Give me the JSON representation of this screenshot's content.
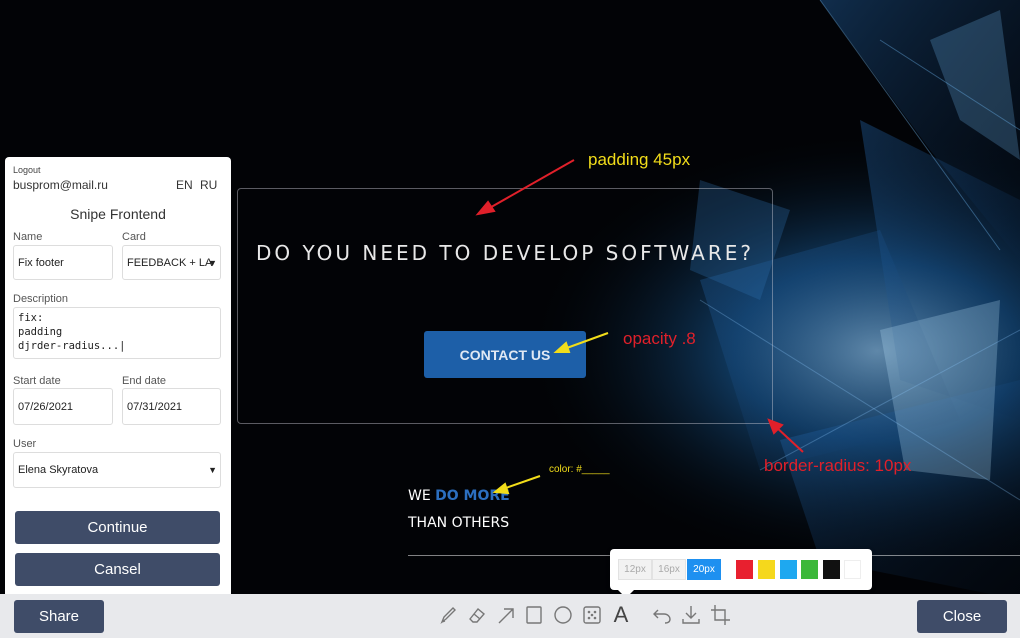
{
  "website": {
    "hero_title": "DO YOU NEED TO DEVELOP SOFTWARE?",
    "contact_button": "CONTACT US",
    "we_prefix": "WE ",
    "we_highlight": "DO MORE",
    "than_others": "THAN OTHERS"
  },
  "annotations": {
    "padding": "padding 45px",
    "opacity": "opacity .8",
    "border_radius": "border-radius: 10px",
    "color": "color: #_____"
  },
  "panel": {
    "logout": "Logout",
    "email": "busprom@mail.ru",
    "lang_en": "EN",
    "lang_ru": "RU",
    "title": "Snipe Frontend",
    "name_label": "Name",
    "name_value": "Fix footer",
    "card_label": "Card",
    "card_value": "FEEDBACK + LA",
    "description_label": "Description",
    "description_value": "fix:\npadding\ndjrder-radius...|",
    "start_label": "Start date",
    "start_value": "07/26/2021",
    "end_label": "End date",
    "end_value": "07/31/2021",
    "user_label": "User",
    "user_value": "Elena Skyratova",
    "continue": "Continue",
    "cancel": "Cansel"
  },
  "toolbar": {
    "share": "Share",
    "close": "Close",
    "tools": [
      "pencil-icon",
      "eraser-icon",
      "arrow-icon",
      "rectangle-icon",
      "circle-icon",
      "blur-icon",
      "text-icon",
      "undo-icon",
      "download-icon",
      "crop-icon"
    ],
    "text_tool_label": "A"
  },
  "popup": {
    "sizes": [
      "12px",
      "16px",
      "20px"
    ],
    "active_size": "20px",
    "colors": [
      "#e8202f",
      "#f5d81c",
      "#1ea8f0",
      "#3cb83a",
      "#111111",
      "#ffffff"
    ]
  }
}
